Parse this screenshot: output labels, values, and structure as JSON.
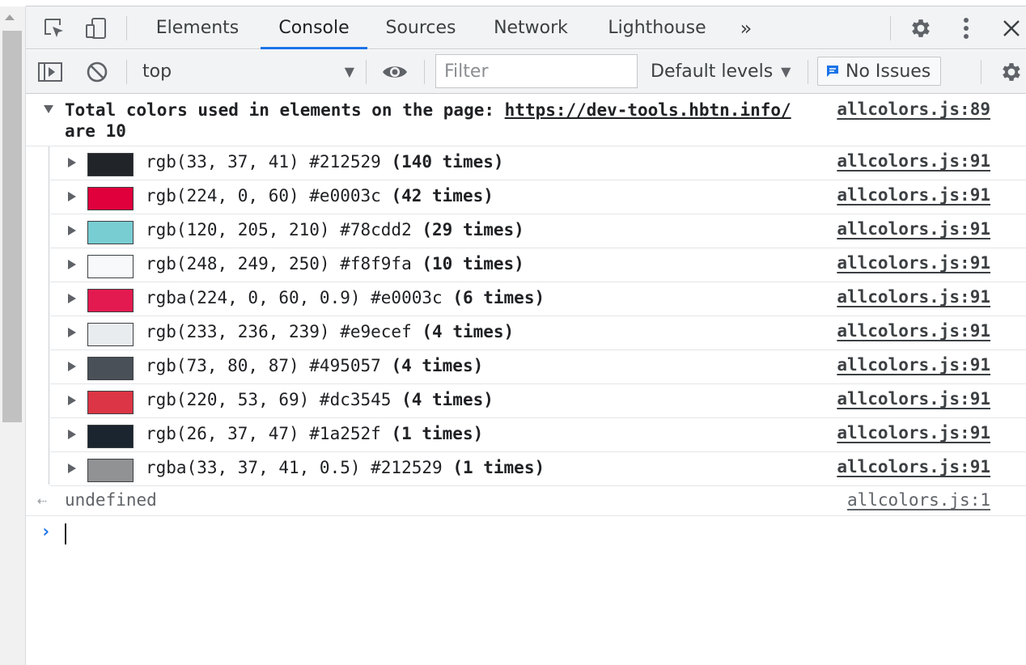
{
  "tabs": [
    {
      "label": "Elements",
      "active": false
    },
    {
      "label": "Console",
      "active": true
    },
    {
      "label": "Sources",
      "active": false
    },
    {
      "label": "Network",
      "active": false
    },
    {
      "label": "Lighthouse",
      "active": false
    }
  ],
  "icons": {
    "inspect": "inspect-element-icon",
    "device": "device-toolbar-icon",
    "more_tabs": "chevron-double-right-icon",
    "settings": "gear-icon",
    "menu": "kebab-menu-icon",
    "close": "close-icon",
    "sidebar": "sidebar-toggle-icon",
    "clear": "clear-console-icon",
    "eye": "eye-icon"
  },
  "toolbar": {
    "context": "top",
    "filter_placeholder": "Filter",
    "levels": "Default levels",
    "issues": "No Issues"
  },
  "group": {
    "title_prefix": "Total colors used in elements on the page: ",
    "url": "https://dev-tools.hbtn.info/",
    "title_suffix": " are 10",
    "source": "allcolors.js:89"
  },
  "rows": [
    {
      "color": "#212529",
      "text": "rgb(33, 37, 41) #212529",
      "count": "(140 times)",
      "source": "allcolors.js:91"
    },
    {
      "color": "#e0003c",
      "text": "rgb(224, 0, 60) #e0003c",
      "count": "(42 times)",
      "source": "allcolors.js:91"
    },
    {
      "color": "#78cdd2",
      "text": "rgb(120, 205, 210) #78cdd2",
      "count": "(29 times)",
      "source": "allcolors.js:91"
    },
    {
      "color": "#f8f9fa",
      "text": "rgb(248, 249, 250) #f8f9fa",
      "count": "(10 times)",
      "source": "allcolors.js:91"
    },
    {
      "color": "#e31a50",
      "text": "rgba(224, 0, 60, 0.9) #e0003c",
      "count": "(6 times)",
      "source": "allcolors.js:91"
    },
    {
      "color": "#e9ecef",
      "text": "rgb(233, 236, 239) #e9ecef",
      "count": "(4 times)",
      "source": "allcolors.js:91"
    },
    {
      "color": "#495057",
      "text": "rgb(73, 80, 87) #495057",
      "count": "(4 times)",
      "source": "allcolors.js:91"
    },
    {
      "color": "#dc3545",
      "text": "rgb(220, 53, 69) #dc3545",
      "count": "(4 times)",
      "source": "allcolors.js:91"
    },
    {
      "color": "#1a252f",
      "text": "rgb(26, 37, 47) #1a252f",
      "count": "(1 times)",
      "source": "allcolors.js:91"
    },
    {
      "color": "#909294",
      "text": "rgba(33, 37, 41, 0.5) #212529",
      "count": "(1 times)",
      "source": "allcolors.js:91"
    }
  ],
  "result": {
    "text": "undefined",
    "source": "allcolors.js:1"
  },
  "colors": {
    "accent": "#1a73e8",
    "toolbar_bg": "#f1f3f4"
  }
}
